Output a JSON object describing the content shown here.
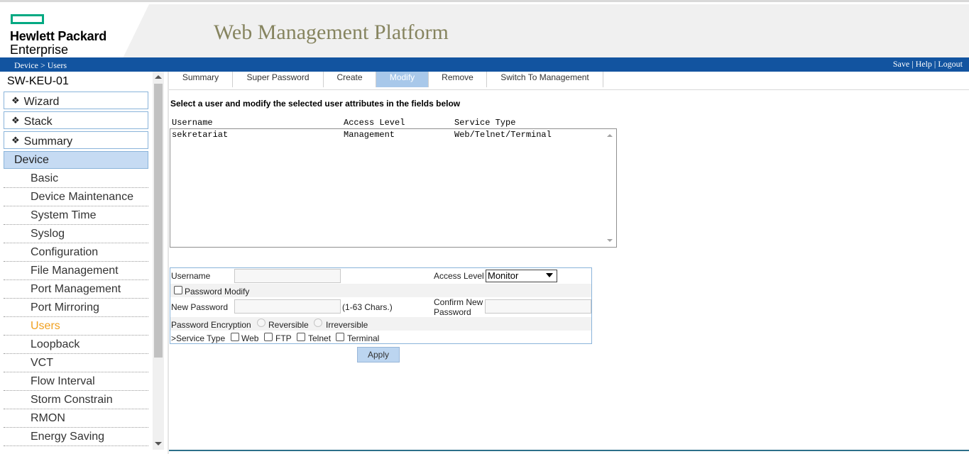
{
  "header": {
    "logo_line1": "Hewlett Packard",
    "logo_line2": "Enterprise",
    "title": "Web Management Platform",
    "colors": {
      "logo_green": "#01a982",
      "title": "#86845f",
      "bar": "#1254a0"
    }
  },
  "bar": {
    "breadcrumb": "Device > Users",
    "links": {
      "save": "Save",
      "sep1": " | ",
      "help": "Help",
      "sep2": " | ",
      "logout": "Logout"
    }
  },
  "sidebar": {
    "device_name": "SW-KEU-01",
    "bullet": "❖",
    "groups": [
      {
        "label": "Wizard"
      },
      {
        "label": "Stack"
      },
      {
        "label": "Summary"
      },
      {
        "label": "Device"
      }
    ],
    "items": [
      {
        "label": "Basic"
      },
      {
        "label": "Device Maintenance"
      },
      {
        "label": "System Time"
      },
      {
        "label": "Syslog"
      },
      {
        "label": "Configuration"
      },
      {
        "label": "File Management"
      },
      {
        "label": "Port Management"
      },
      {
        "label": "Port Mirroring"
      },
      {
        "label": "Users"
      },
      {
        "label": "Loopback"
      },
      {
        "label": "VCT"
      },
      {
        "label": "Flow Interval"
      },
      {
        "label": "Storm Constrain"
      },
      {
        "label": "RMON"
      },
      {
        "label": "Energy Saving"
      }
    ],
    "active_item": "Users"
  },
  "tabs": [
    {
      "label": "Summary"
    },
    {
      "label": "Super Password"
    },
    {
      "label": "Create"
    },
    {
      "label": "Modify"
    },
    {
      "label": "Remove"
    },
    {
      "label": "Switch To Management"
    }
  ],
  "active_tab": "Modify",
  "main": {
    "instruction": "Select a user and modify the selected user attributes in the fields below",
    "list": {
      "columns": [
        "Username",
        "Access Level",
        "Service Type"
      ],
      "rows": [
        {
          "username": "sekretariat",
          "access_level": "Management",
          "service_type": "Web/Telnet/Terminal"
        }
      ]
    },
    "form": {
      "username_label": "Username",
      "username_value": "",
      "access_level_label": "Access Level",
      "access_level_value": "Monitor",
      "password_modify_label": "Password Modify",
      "new_password_label": "New Password",
      "password_hint": "(1-63 Chars.)",
      "confirm_label_1": "Confirm New",
      "confirm_label_2": "Password",
      "encryption_label": "Password Encryption",
      "reversible_label": "Reversible",
      "irreversible_label": "Irreversible",
      "service_type_label": ">Service Type",
      "service_web": "Web",
      "service_ftp": "FTP",
      "service_telnet": "Telnet",
      "service_terminal": "Terminal"
    },
    "apply_label": "Apply"
  }
}
